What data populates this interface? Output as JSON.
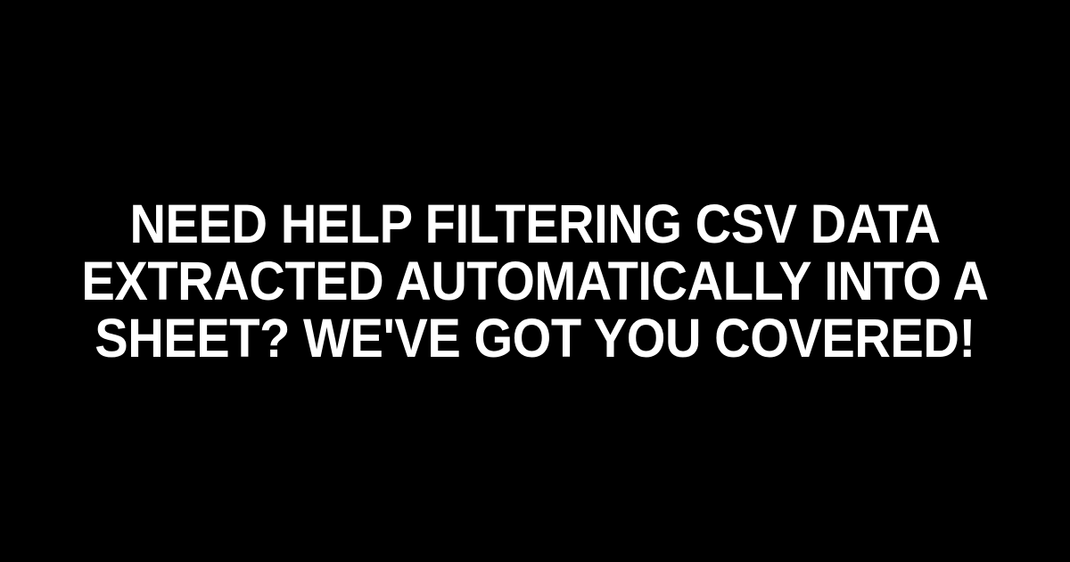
{
  "headline": "Need Help Filtering CSV Data Extracted Automatically into a Sheet? We've Got You Covered!"
}
